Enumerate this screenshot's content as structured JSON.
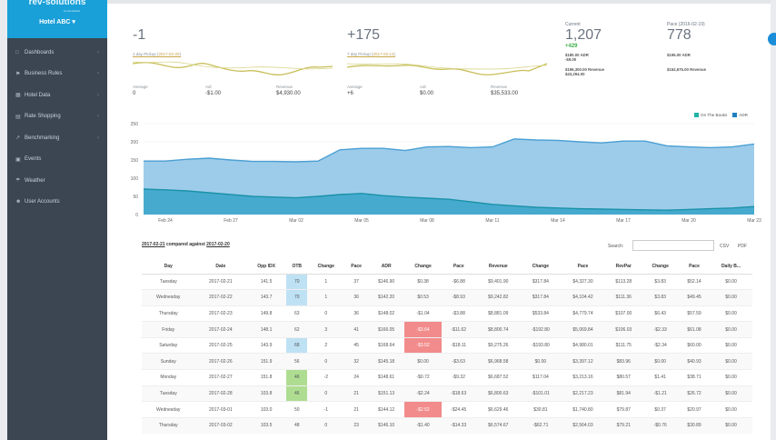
{
  "brand": {
    "logo": "rev-solutions",
    "sub": "by kendrahiel",
    "hotel": "Hotel ABC ▾"
  },
  "sidebar": {
    "items": [
      {
        "icon": "□",
        "label": "Dashboards",
        "chev": "‹"
      },
      {
        "icon": "⚑",
        "label": "Business Rules",
        "chev": "‹"
      },
      {
        "icon": "▦",
        "label": "Hotel Data",
        "chev": "‹"
      },
      {
        "icon": "▤",
        "label": "Rate Shopping",
        "chev": "‹"
      },
      {
        "icon": "↗",
        "label": "Benchmarking",
        "chev": "‹"
      },
      {
        "icon": "▣",
        "label": "Events",
        "chev": ""
      },
      {
        "icon": "☂",
        "label": "Weather",
        "chev": ""
      },
      {
        "icon": "☻",
        "label": "User Accounts",
        "chev": ""
      }
    ]
  },
  "kpi1": {
    "big": "-1",
    "pickup": "1 day Pickup",
    "pickup_date": "2017-02-20",
    "avg_label": "Average",
    "avg_value": "0",
    "adr_label": "Adr",
    "adr_value": "-$1.00",
    "rev_label": "Revenue",
    "rev_value": "$4,930.00"
  },
  "kpi2": {
    "big": "+175",
    "pickup": "7 day Pickup",
    "pickup_date": "2017-02-14",
    "avg_label": "Average",
    "avg_value": "+6",
    "adr_label": "Adr",
    "adr_value": "$0.00",
    "rev_label": "Revenue",
    "rev_value": "$35,533.00"
  },
  "current": {
    "head": "Current",
    "big": "1,207",
    "delta": "+429",
    "adr": "$180.00 ADR",
    "adr_delta": "-$9.00",
    "rev": "$196,300.00 Revenue",
    "rev_delta": "$43,294.00"
  },
  "pace": {
    "head": "Pace (2016-02-19)",
    "big": "778",
    "adr": "$195.00 ADR",
    "rev": "$152,675.00 Revenue"
  },
  "chart_data": {
    "type": "area",
    "x": [
      "Feb 23",
      "Feb 24",
      "Feb 25",
      "Feb 26",
      "Feb 27",
      "Feb 28",
      "Mar 01",
      "Mar 02",
      "Mar 03",
      "Mar 04",
      "Mar 05",
      "Mar 06",
      "Mar 07",
      "Mar 08",
      "Mar 09",
      "Mar 10",
      "Mar 11",
      "Mar 12",
      "Mar 13",
      "Mar 14",
      "Mar 15",
      "Mar 16",
      "Mar 17",
      "Mar 18",
      "Mar 19",
      "Mar 20",
      "Mar 21",
      "Mar 22",
      "Mar 23"
    ],
    "xticks": [
      "Feb 24",
      "Feb 27",
      "Mar 02",
      "Mar 05",
      "Mar 08",
      "Mar 11",
      "Mar 14",
      "Mar 17",
      "Mar 20",
      "Mar 23"
    ],
    "yticks": [
      0,
      50,
      100,
      150,
      200,
      250
    ],
    "ylim": [
      0,
      250
    ],
    "series": [
      {
        "name": "On The Books",
        "color": "#20b4a6",
        "values": [
          70,
          68,
          65,
          60,
          55,
          50,
          48,
          46,
          50,
          55,
          58,
          52,
          48,
          45,
          42,
          35,
          28,
          24,
          20,
          18,
          16,
          15,
          14,
          13,
          12,
          14,
          16,
          18,
          22
        ]
      },
      {
        "name": "ADR",
        "color": "#1f7fc0",
        "values": [
          147,
          147,
          152,
          155,
          150,
          146,
          146,
          145,
          147,
          178,
          182,
          182,
          176,
          186,
          187,
          184,
          186,
          208,
          205,
          204,
          200,
          197,
          202,
          202,
          189,
          186,
          184,
          186,
          194
        ]
      }
    ]
  },
  "table": {
    "title_date1": "2017-02-21",
    "title_mid": " compared against ",
    "title_date2": "2017-02-20",
    "search_label": "Search:",
    "search_placeholder": "",
    "csv": "CSV",
    "pdf": "PDF",
    "headers": [
      "Day",
      "Date",
      "Opp IDX",
      "OTB",
      "Change",
      "Pace",
      "ADR",
      "Change",
      "Pace",
      "Revenue",
      "Change",
      "Pace",
      "RevPar",
      "Change",
      "Pace",
      "Daily B..."
    ],
    "rows": [
      [
        "Tuesday",
        "2017-02-21",
        "141.5",
        "70",
        "1",
        "37",
        "$146.90",
        "$0.38",
        "-$6.88",
        "$9,401.90",
        "$317.84",
        "$4,327.30",
        "$113.28",
        "$3.83",
        "$52.14",
        "$0.00"
      ],
      [
        "Wednesday",
        "2017-02-22",
        "143.7",
        "70",
        "1",
        "36",
        "$142.20",
        "$0.53",
        "-$8.93",
        "$9,242.82",
        "$317.84",
        "$4,104.42",
        "$111.36",
        "$3.83",
        "$49.45",
        "$0.00"
      ],
      [
        "Thursday",
        "2017-02-23",
        "149.8",
        "63",
        "0",
        "36",
        "$148.02",
        "-$1.04",
        "-$3.88",
        "$8,881.09",
        "$533.84",
        "$4,779.74",
        "$107.00",
        "$6.43",
        "$57.59",
        "$0.00"
      ],
      [
        "Friday",
        "2017-02-24",
        "148.1",
        "62",
        "3",
        "41",
        "$166.05",
        "-$3.64",
        "-$11.62",
        "$8,800.74",
        "-$192.80",
        "$5,069.84",
        "$106.03",
        "-$2.33",
        "$61.08",
        "$0.00"
      ],
      [
        "Saturday",
        "2017-02-25",
        "143.9",
        "68",
        "2",
        "45",
        "$168.64",
        "-$3.52",
        "-$18.11",
        "$9,275.26",
        "-$193.80",
        "$4,980.01",
        "$111.75",
        "-$2.34",
        "$60.00",
        "$0.00"
      ],
      [
        "Sunday",
        "2017-02-26",
        "151.9",
        "56",
        "0",
        "32",
        "$145.18",
        "$0.00",
        "-$3.63",
        "$6,968.58",
        "$0.00",
        "$3,397.12",
        "$83.96",
        "$0.00",
        "$40.93",
        "$0.00"
      ],
      [
        "Monday",
        "2017-02-27",
        "151.8",
        "46",
        "-2",
        "24",
        "$148.61",
        "-$0.72",
        "-$9.32",
        "$6,687.52",
        "$117.04",
        "$3,213.16",
        "$80.57",
        "$1.41",
        "$38.71",
        "$0.00"
      ],
      [
        "Tuesday",
        "2017-02-28",
        "103.8",
        "46",
        "0",
        "21",
        "$151.13",
        "-$2.24",
        "-$18.63",
        "$6,800.63",
        "-$101.01",
        "$2,217.23",
        "$81.94",
        "-$1.21",
        "$26.72",
        "$0.00"
      ],
      [
        "Wednesday",
        "2017-03-01",
        "103.0",
        "50",
        "-1",
        "21",
        "$144.12",
        "-$2.52",
        "-$24.45",
        "$6,629.46",
        "$30.81",
        "$1,740.80",
        "$79.87",
        "$0.37",
        "$20.97",
        "$0.00"
      ],
      [
        "Thursday",
        "2017-03-02",
        "103.5",
        "48",
        "0",
        "23",
        "$146.10",
        "-$1.40",
        "-$14.33",
        "$6,574.67",
        "-$62.71",
        "$2,564.03",
        "$79.21",
        "-$0.76",
        "$30.89",
        "$0.00"
      ]
    ],
    "highlight": {
      "blue": [
        [
          0,
          3
        ],
        [
          1,
          3
        ],
        [
          4,
          3
        ]
      ],
      "green": [
        [
          6,
          3
        ],
        [
          7,
          3
        ]
      ],
      "red": [
        [
          3,
          7
        ],
        [
          4,
          7
        ],
        [
          8,
          7
        ]
      ]
    }
  }
}
